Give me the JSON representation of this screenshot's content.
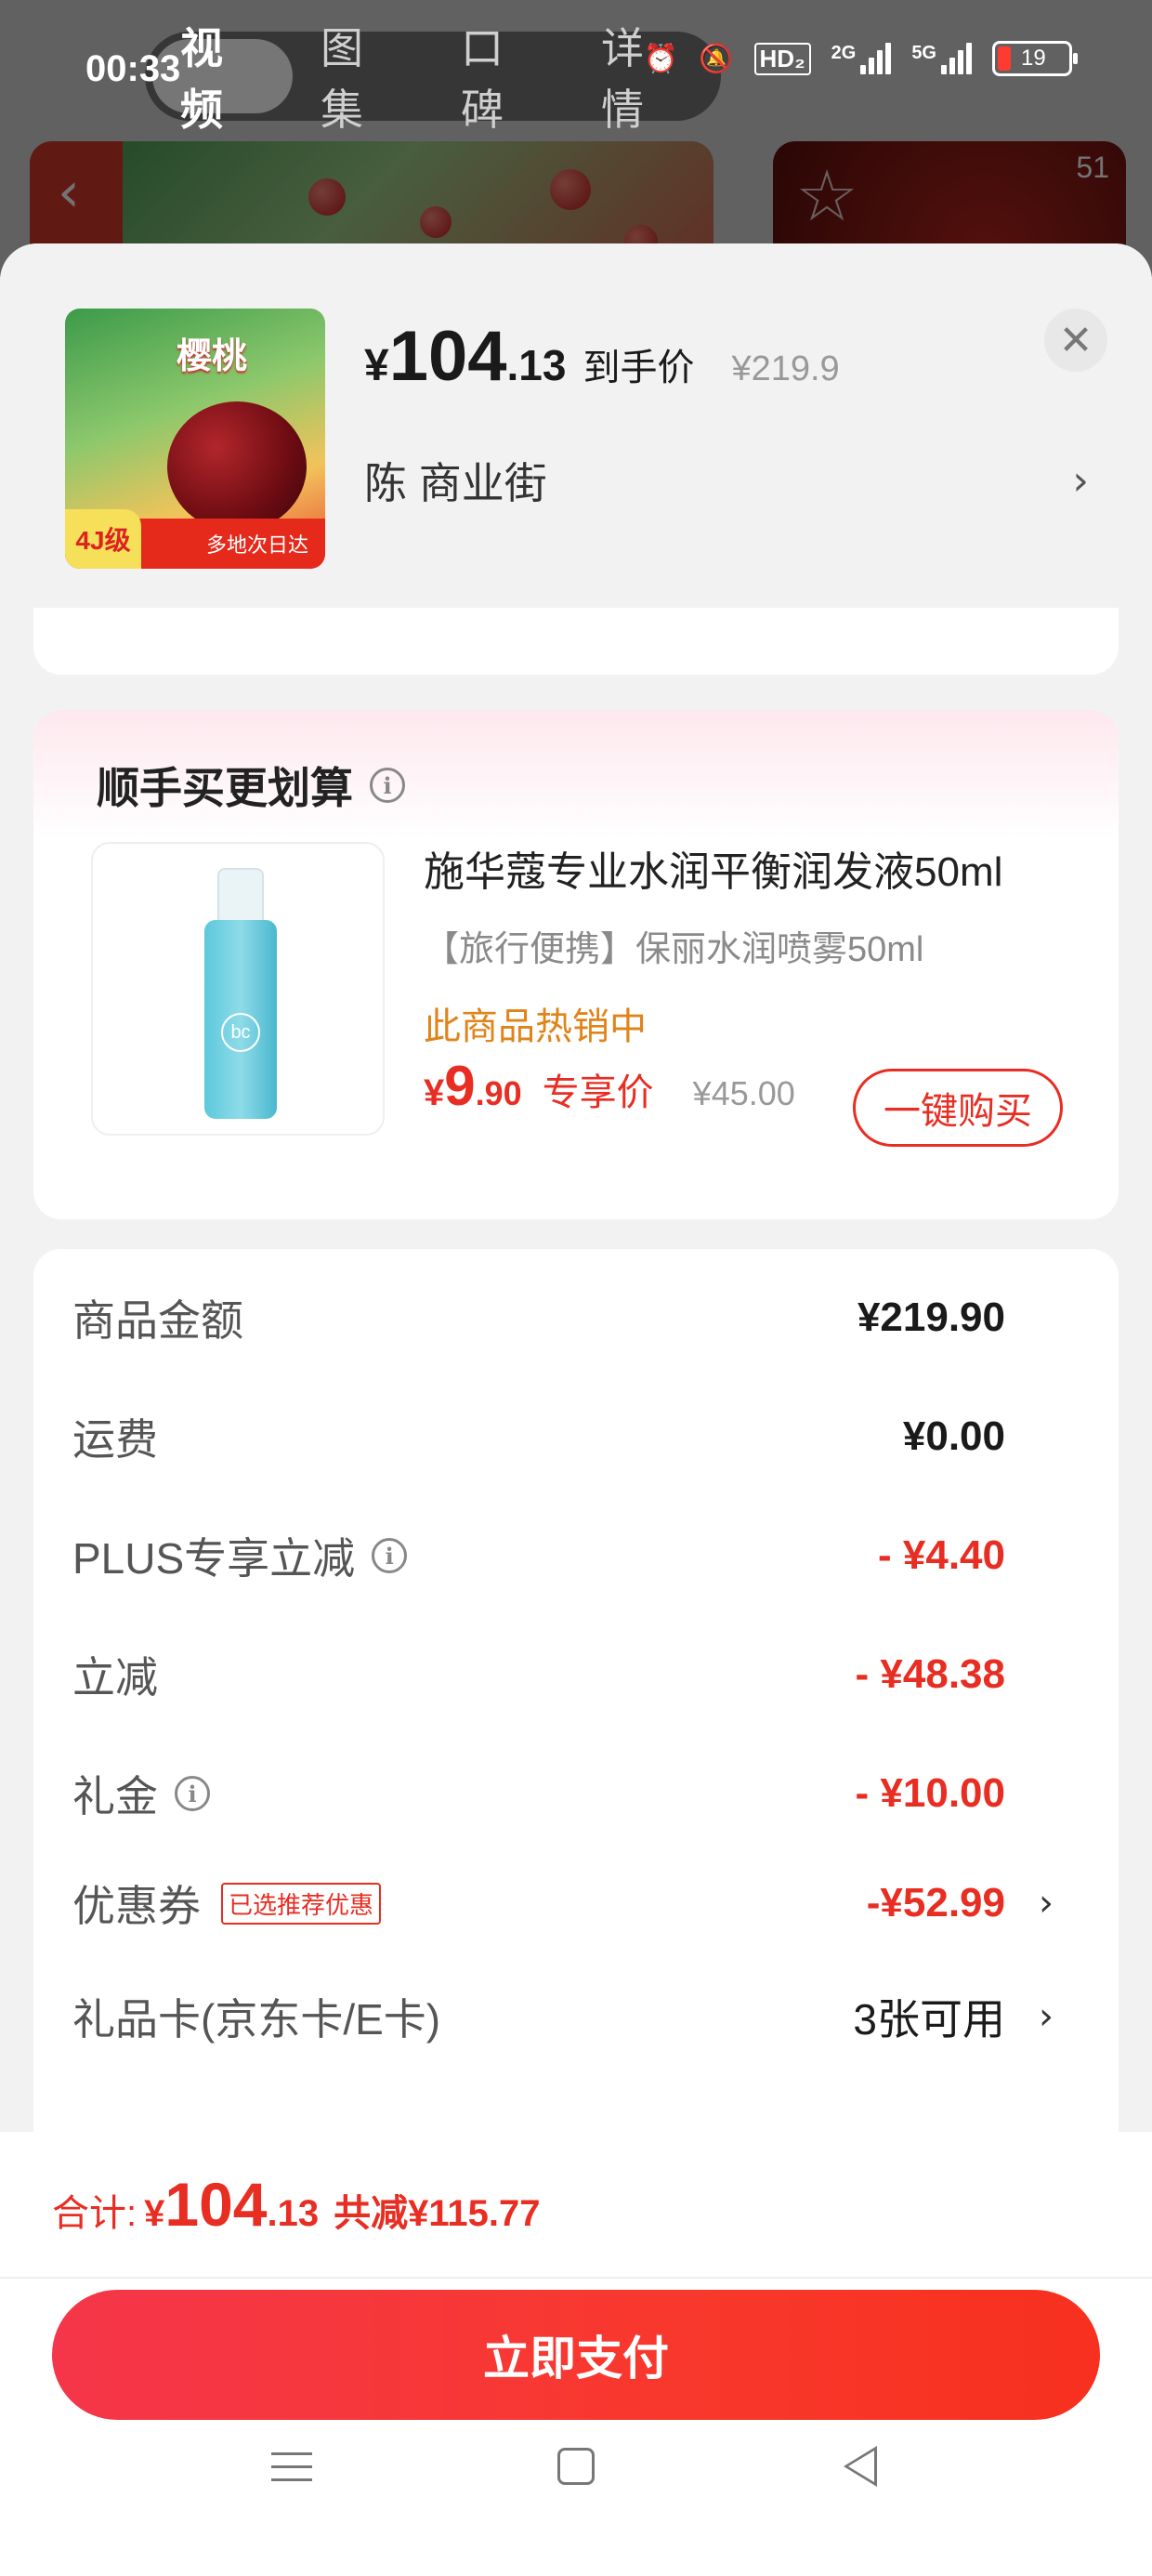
{
  "status_bar": {
    "time": "00:33",
    "network_hd": "HD₂",
    "network_2g": "2G",
    "network_5g": "5G",
    "battery": "19"
  },
  "top_tabs": [
    "视频",
    "图集",
    "口碑",
    "详情"
  ],
  "background": {
    "thumb_count": "51"
  },
  "product": {
    "image_brand": "樱桃",
    "image_tag": "多地次日达",
    "image_grade": "4J级",
    "price_currency": "¥",
    "price_int": "104",
    "price_dec": ".13",
    "price_label": "到手价",
    "original_price": "¥219.9",
    "address": "陈  商业街"
  },
  "upsell": {
    "title": "顺手买更划算",
    "item_name": "施华蔻专业水润平衡润发液50ml",
    "item_subtitle": "【旅行便携】保丽水润喷雾50ml",
    "hot_label": "此商品热销中",
    "price_currency": "¥",
    "price_int": "9",
    "price_dec": ".90",
    "price_label": "专享价",
    "original_price": "¥45.00",
    "buy_button": "一键购买",
    "bottle_logo": "bc"
  },
  "fees": [
    {
      "label": "商品金额",
      "value": "¥219.90"
    },
    {
      "label": "运费",
      "value": "¥0.00"
    },
    {
      "label": "PLUS专享立减",
      "value": "- ¥4.40"
    },
    {
      "label": "立减",
      "value": "- ¥48.38"
    },
    {
      "label": "礼金",
      "value": "- ¥10.00"
    },
    {
      "label": "优惠券",
      "badge": "已选推荐优惠",
      "value": "-¥52.99"
    },
    {
      "label": "礼品卡(京东卡/E卡)",
      "value": "3张可用"
    }
  ],
  "footer": {
    "total_label": "合计:",
    "total_currency": "¥",
    "total_int": "104",
    "total_dec": ".13",
    "total_saved": "共减¥115.77",
    "pay_button": "立即支付"
  },
  "colors": {
    "accent_red": "#e82d22",
    "hot_orange": "#e0841a",
    "pay_gradient_start": "#f5364a",
    "pay_gradient_end": "#f7301f"
  }
}
